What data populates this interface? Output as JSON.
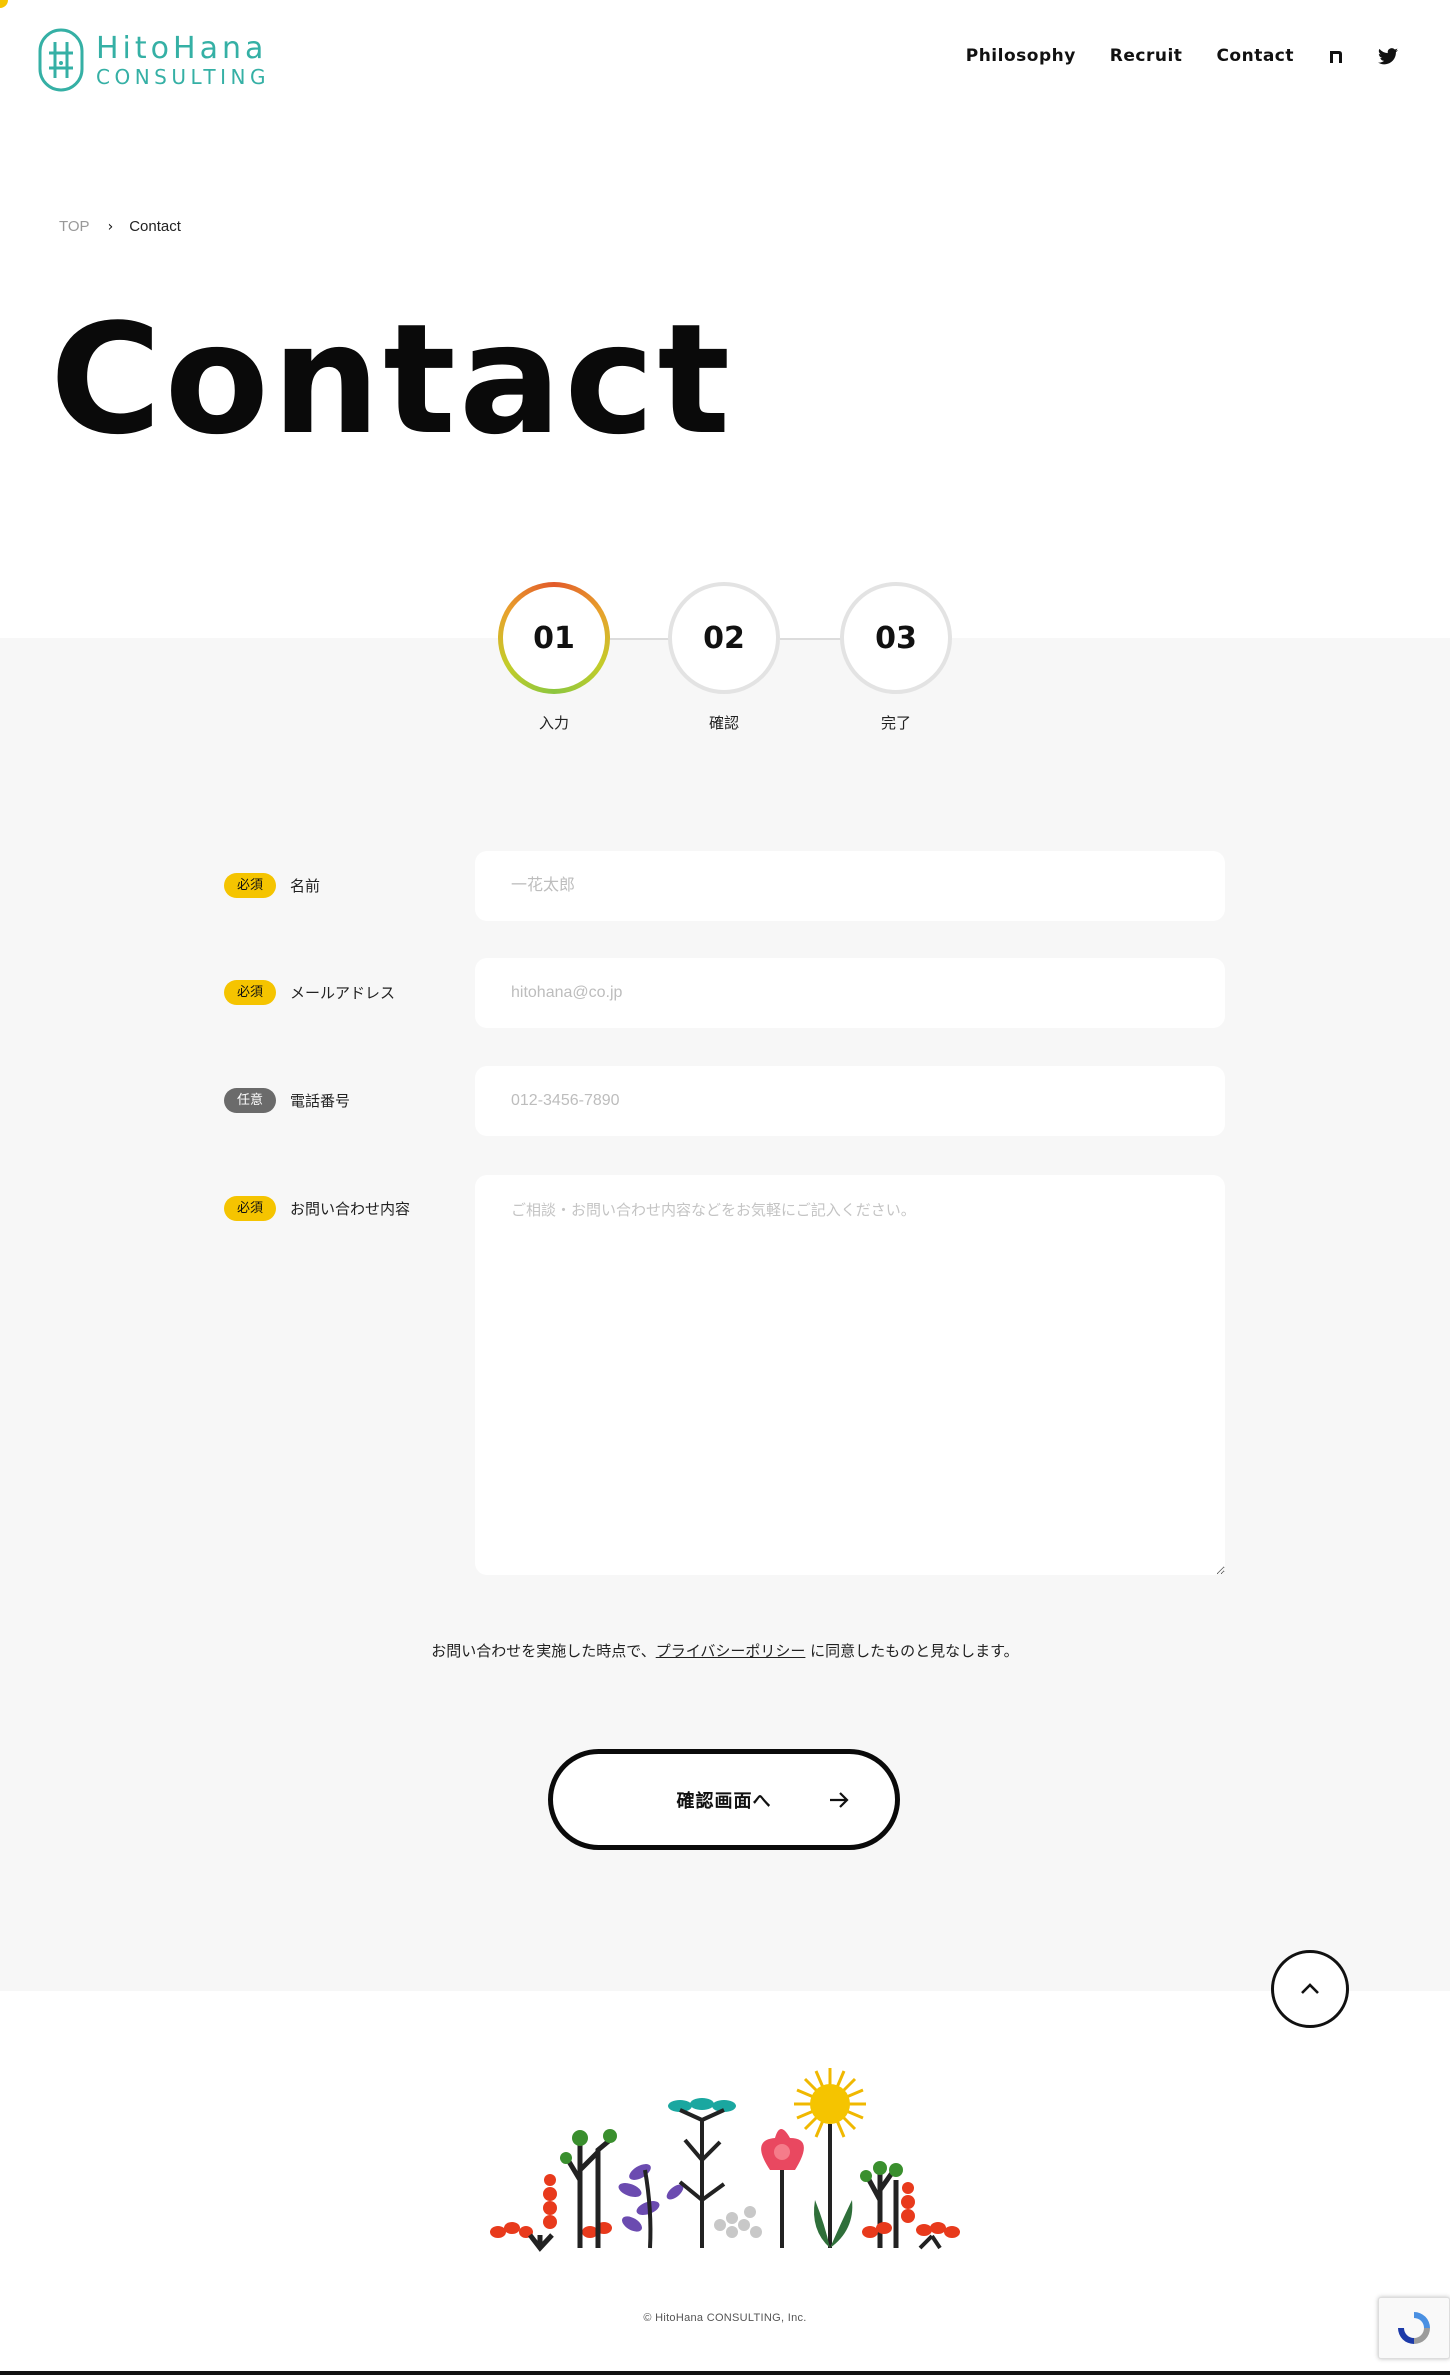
{
  "brand": {
    "name_line1": "HitoHana",
    "name_line2": "CONSULTING",
    "color": "#35b0a5"
  },
  "nav": {
    "items": [
      {
        "label": "Philosophy"
      },
      {
        "label": "Recruit"
      },
      {
        "label": "Contact"
      }
    ],
    "icons": [
      "note-icon",
      "twitter-icon"
    ]
  },
  "breadcrumb": {
    "home": "TOP",
    "current": "Contact"
  },
  "page": {
    "title": "Contact"
  },
  "steps": [
    {
      "number": "01",
      "label": "入力",
      "active": true
    },
    {
      "number": "02",
      "label": "確認",
      "active": false
    },
    {
      "number": "03",
      "label": "完了",
      "active": false
    }
  ],
  "form": {
    "name": {
      "badge": "必須",
      "label": "名前",
      "placeholder": "一花太郎"
    },
    "email": {
      "badge": "必須",
      "label": "メールアドレス",
      "placeholder": "hitohana@co.jp"
    },
    "phone": {
      "badge": "任意",
      "label": "電話番号",
      "placeholder": "012-3456-7890"
    },
    "message": {
      "badge": "必須",
      "label": "お問い合わせ内容",
      "placeholder": "ご相談・お問い合わせ内容などをお気軽にご記入ください。"
    }
  },
  "consent": {
    "before": "お問い合わせを実施した時点で、",
    "link": "プライバシーポリシー",
    "after": " に同意したものと見なします。"
  },
  "submit": {
    "label": "確認画面へ"
  },
  "footer": {
    "copyright": "© HitoHana CONSULTING, Inc."
  },
  "colors": {
    "required_badge": "#f5c400",
    "optional_badge": "#6b6b6b",
    "section_bg": "#f7f7f7",
    "accent_yellow": "#f5c400"
  }
}
